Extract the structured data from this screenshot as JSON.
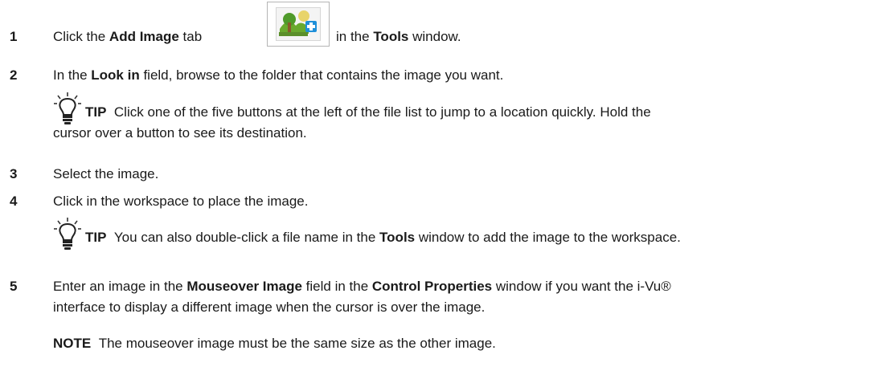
{
  "steps": [
    {
      "number": "1",
      "before": "Click the ",
      "bold1": "Add Image",
      "mid": " tab",
      "after_icon": "in the ",
      "bold2": "Tools",
      "end": " window."
    },
    {
      "number": "2",
      "before": "In the ",
      "bold1": "Look in",
      "end": " field, browse to the folder that contains the image you want."
    },
    {
      "number": "3",
      "text": "Select the image."
    },
    {
      "number": "4",
      "text": "Click in the workspace to place the image."
    },
    {
      "number": "5",
      "before": "Enter an image in the ",
      "bold1": "Mouseover Image",
      "mid": " field in the ",
      "bold2": "Control Properties",
      "end1": " window if you want the i-Vu®",
      "line2": "interface to display a different image when the cursor is over the image."
    }
  ],
  "tips": [
    {
      "label": "TIP",
      "line1": "Click one of the five buttons at the left of the file list to jump to a location quickly. Hold the",
      "line2": "cursor over a button to see its destination."
    },
    {
      "label": "TIP",
      "before": "You can also double-click a file name in the ",
      "bold": "Tools",
      "after": " window to add the image to the workspace."
    }
  ],
  "note": {
    "label": "NOTE",
    "text": "The mouseover image must be the same size as the other image."
  },
  "icons": {
    "add_image": "add-image-icon",
    "tip": "lightbulb-icon"
  },
  "colors": {
    "text": "#1a1a1a",
    "icon_green": "#6aaa2e",
    "icon_blue": "#1e8fd9",
    "icon_sky": "#e8d46a"
  }
}
